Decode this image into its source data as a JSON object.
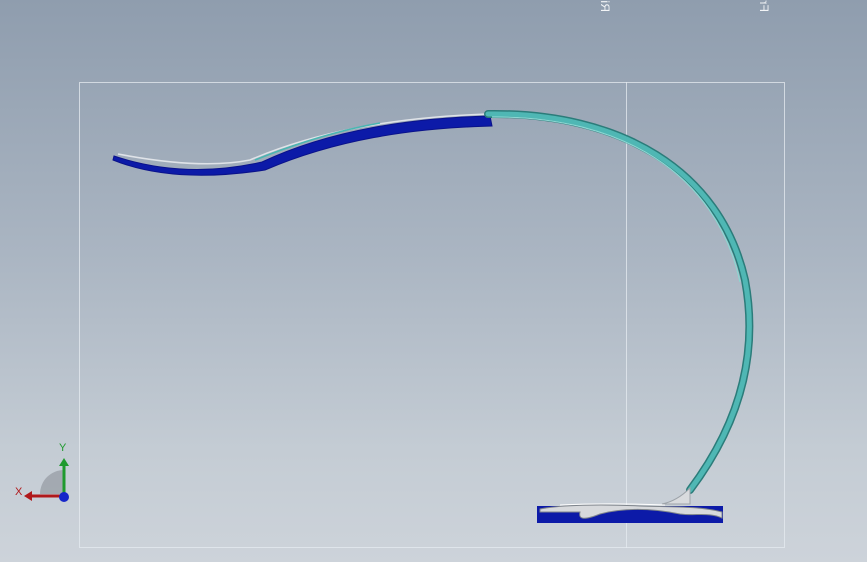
{
  "viewport": {
    "planes": [
      {
        "name": "Right Plane",
        "label": "Right Plane"
      },
      {
        "name": "Front Plane",
        "label": "Front Plane"
      }
    ]
  },
  "triad": {
    "x_label": "X",
    "y_label": "Y",
    "colors": {
      "x": "#b0191b",
      "y": "#1f9a2e",
      "z": "#1626c9"
    }
  },
  "colors": {
    "background_top": "#8f9dae",
    "background_bottom": "#cdd3da",
    "selected_blue": "#0c1aa8",
    "teal": "#3fa5a3",
    "silver": "#d7d9dc"
  }
}
